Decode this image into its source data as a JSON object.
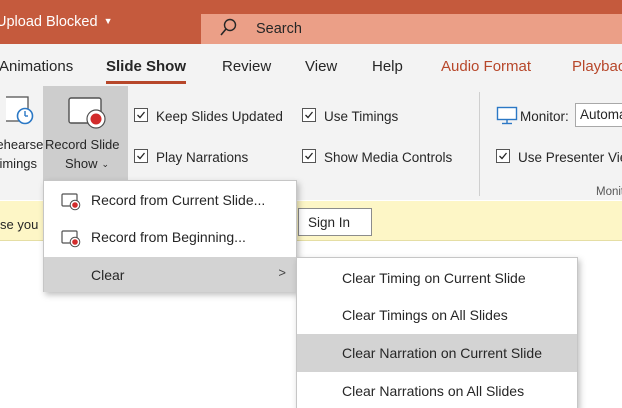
{
  "titlebar": {
    "title": "Upload Blocked",
    "search_label": "Search"
  },
  "tabs": [
    "Animations",
    "Slide Show",
    "Review",
    "View",
    "Help",
    "Audio Format",
    "Playback"
  ],
  "ribbon": {
    "rehearse_line1": "Rehearse",
    "rehearse_line2": "Timings",
    "record_line1": "Record Slide",
    "record_line2": "Show",
    "checkboxes": [
      {
        "label": "Keep Slides Updated",
        "checked": true
      },
      {
        "label": "Use Timings",
        "checked": true
      },
      {
        "label": "Play Narrations",
        "checked": true
      },
      {
        "label": "Show Media Controls",
        "checked": true
      },
      {
        "label": "Use Presenter View",
        "checked": true
      }
    ],
    "monitor_label": "Monitor:",
    "monitor_value": "Automatic",
    "group_label": "Monitors"
  },
  "message_bar": {
    "text": "Please you",
    "signin_label": "Sign In"
  },
  "record_menu": {
    "items": [
      {
        "icon": "record-slide-icon",
        "label": "Record from Current Slide..."
      },
      {
        "icon": "record-slide-icon",
        "label": "Record from Beginning..."
      },
      {
        "label": "Clear"
      }
    ]
  },
  "clear_menu": {
    "items": [
      {
        "label": "Clear Timing on Current Slide"
      },
      {
        "label": "Clear Timings on All Slides"
      },
      {
        "label": "Clear Narration on Current Slide"
      },
      {
        "label": "Clear Narrations on All Slides"
      }
    ]
  },
  "colors": {
    "title_bar": "#c55a3d",
    "search_box": "#eb9f87",
    "accent": "#b7472a",
    "ribbon_bg": "#f3f3f3",
    "message_bar": "#fdf6c6",
    "menu_highlight": "#d3d3d3"
  }
}
